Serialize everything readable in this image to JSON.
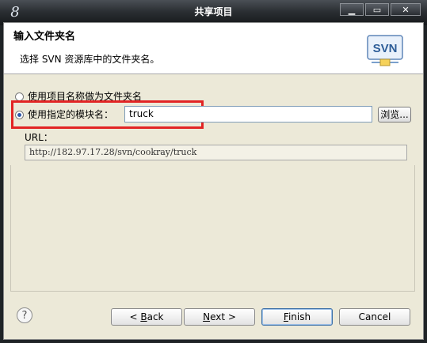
{
  "window": {
    "title": "共享项目",
    "app_icon_glyph": "8",
    "controls": {
      "minimize": "▁",
      "maximize": "▭",
      "close": "✕"
    }
  },
  "header": {
    "title": "输入文件夹名",
    "description": "选择 SVN 资源库中的文件夹名。",
    "logo_text": "SVN"
  },
  "options": {
    "use_project_name_label": "使用项目名称做为文件夹名",
    "use_project_name_selected": false,
    "use_module_name_label": "使用指定的模块名：",
    "use_module_name_selected": true,
    "module_name_value": "truck",
    "browse_label": "浏览..."
  },
  "url": {
    "label": "URL：",
    "value": "http://182.97.17.28/svn/cookray/truck"
  },
  "buttons": {
    "help_glyph": "?",
    "back_prefix": "< ",
    "back_mnemonic": "B",
    "back_rest": "ack",
    "next_mnemonic": "N",
    "next_rest": "ext >",
    "finish_mnemonic": "F",
    "finish_rest": "inish",
    "cancel": "Cancel"
  },
  "colors": {
    "highlight": "#e22424",
    "accent": "#2f58a8"
  }
}
